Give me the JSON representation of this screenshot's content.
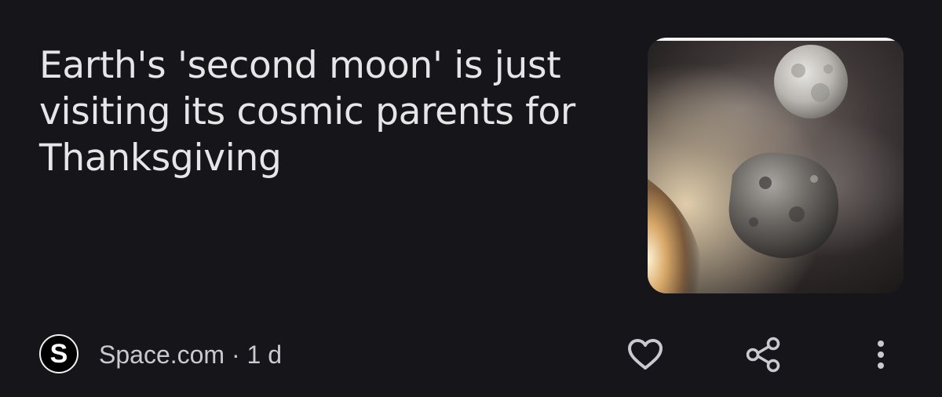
{
  "article": {
    "headline": "Earth's 'second moon' is just visiting its cosmic parents for Thanksgiving",
    "source_logo_letter": "S",
    "source_meta": "Space.com · 1 d"
  },
  "icons": {
    "like": "heart-outline-icon",
    "share": "share-icon",
    "more": "more-vertical-icon"
  },
  "colors": {
    "background": "#16161a",
    "headline_text": "#e6e6e9",
    "meta_text": "#c9c9cf",
    "icon": "#c9c9cf"
  }
}
